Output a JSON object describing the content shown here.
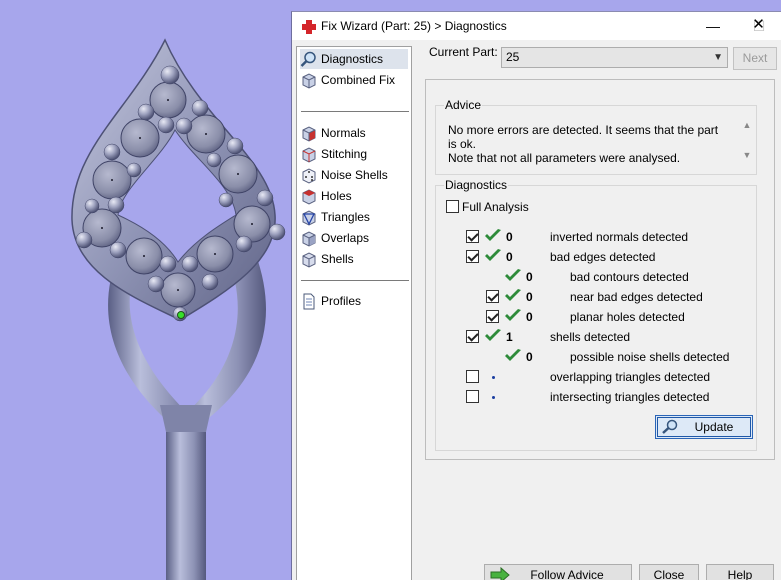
{
  "window": {
    "title": "Fix Wizard (Part: 25) > Diagnostics",
    "minimize_glyph": "—",
    "maximize_glyph": "☐",
    "close_glyph": "✕"
  },
  "nav": {
    "items": [
      {
        "label": "Diagnostics",
        "icon": "magnifier-icon"
      },
      {
        "label": "Combined Fix",
        "icon": "cube-icon"
      },
      {
        "label": "Normals",
        "icon": "red-cube-icon"
      },
      {
        "label": "Stitching",
        "icon": "stitching-cube-icon"
      },
      {
        "label": "Noise Shells",
        "icon": "dice-icon"
      },
      {
        "label": "Holes",
        "icon": "hole-cube-icon"
      },
      {
        "label": "Triangles",
        "icon": "triangle-icon"
      },
      {
        "label": "Overlaps",
        "icon": "overlap-cube-icon"
      },
      {
        "label": "Shells",
        "icon": "shells-cube-icon"
      },
      {
        "label": "Profiles",
        "icon": "document-icon"
      }
    ]
  },
  "current_part": {
    "label": "Current Part:",
    "value": "25",
    "next_label": "Next"
  },
  "advice": {
    "label": "Advice",
    "line1": "No more errors are detected. It seems that the part is ok.",
    "line2": "Note that not all parameters were analysed."
  },
  "diagnostics": {
    "label": "Diagnostics",
    "full_analysis_label": "Full Analysis",
    "rows": [
      {
        "count": "0",
        "text": "inverted normals detected"
      },
      {
        "count": "0",
        "text": "bad edges detected"
      },
      {
        "count": "0",
        "text": "bad contours detected"
      },
      {
        "count": "0",
        "text": "near bad edges detected"
      },
      {
        "count": "0",
        "text": "planar holes detected"
      },
      {
        "count": "1",
        "text": "shells detected"
      },
      {
        "count": "0",
        "text": "possible noise shells detected"
      },
      {
        "count": "",
        "text": "overlapping triangles detected"
      },
      {
        "count": "",
        "text": "intersecting triangles detected"
      }
    ],
    "update_label": "Update"
  },
  "buttons": {
    "follow_advice": "Follow Advice",
    "close": "Close",
    "help": "Help"
  },
  "colors": {
    "viewport_bg": "#a7a6ec",
    "model": "#8c93b6",
    "check_green": "#2e8b3a",
    "accent_blue": "#2b65b7"
  }
}
